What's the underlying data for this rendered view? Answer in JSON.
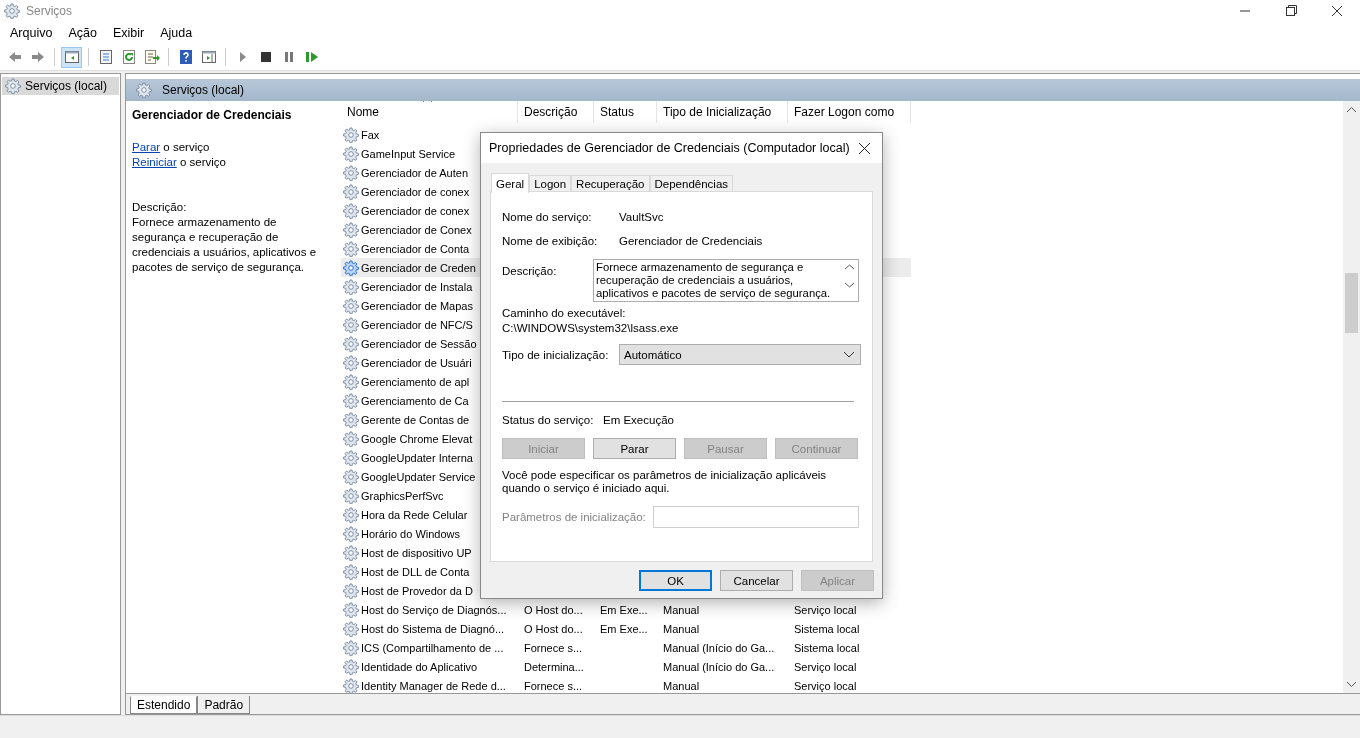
{
  "window": {
    "title": "Serviços"
  },
  "menu": [
    "Arquivo",
    "Ação",
    "Exibir",
    "Ajuda"
  ],
  "toolbar": [
    {
      "kind": "back",
      "pressed": false
    },
    {
      "kind": "forward",
      "pressed": false
    },
    {
      "kind": "sep"
    },
    {
      "kind": "console-tree",
      "pressed": true
    },
    {
      "kind": "sep"
    },
    {
      "kind": "properties",
      "pressed": false
    },
    {
      "kind": "refresh",
      "pressed": false
    },
    {
      "kind": "export",
      "pressed": false
    },
    {
      "kind": "sep"
    },
    {
      "kind": "help",
      "pressed": false
    },
    {
      "kind": "action-pane",
      "pressed": false
    },
    {
      "kind": "sep"
    },
    {
      "kind": "play",
      "pressed": false
    },
    {
      "kind": "stop",
      "pressed": false
    },
    {
      "kind": "pause",
      "pressed": false
    },
    {
      "kind": "resume",
      "pressed": false
    }
  ],
  "tree": {
    "items": [
      {
        "label": "Serviços (local)",
        "selected": true
      }
    ]
  },
  "panel": {
    "title": "Serviços (local)"
  },
  "details": {
    "service": "Gerenciador de Credenciais",
    "actions": [
      {
        "link": "Parar",
        "text": "o serviço"
      },
      {
        "link": "Reiniciar",
        "text": "o serviço"
      }
    ],
    "description_label": "Descrição:",
    "description": "Fornece armazenamento de segurança e recuperação de credenciais a usuários, aplicativos e pacotes de serviço de segurança."
  },
  "table": {
    "columns": [
      "Nome",
      "Descrição",
      "Status",
      "Tipo de Inicialização",
      "Fazer Logon como"
    ],
    "rows": [
      {
        "name": "Fax",
        "selected": false
      },
      {
        "name": "GameInput Service",
        "selected": false
      },
      {
        "name": "Gerenciador de Auten",
        "selected": false
      },
      {
        "name": "Gerenciador de conex",
        "selected": false
      },
      {
        "name": "Gerenciador de conex",
        "selected": false
      },
      {
        "name": "Gerenciador de Conex",
        "selected": false
      },
      {
        "name": "Gerenciador de Conta",
        "selected": false
      },
      {
        "name": "Gerenciador de Creden",
        "selected": true
      },
      {
        "name": "Gerenciador de Instala",
        "selected": false
      },
      {
        "name": "Gerenciador de Mapas",
        "selected": false
      },
      {
        "name": "Gerenciador de NFC/S",
        "selected": false
      },
      {
        "name": "Gerenciador de Sessão",
        "selected": false
      },
      {
        "name": "Gerenciador de Usuári",
        "selected": false
      },
      {
        "name": "Gerenciamento de apl",
        "selected": false
      },
      {
        "name": "Gerenciamento de Ca",
        "selected": false
      },
      {
        "name": "Gerente de Contas de",
        "selected": false
      },
      {
        "name": "Google Chrome Elevat",
        "selected": false
      },
      {
        "name": "GoogleUpdater Interna",
        "selected": false
      },
      {
        "name": "GoogleUpdater Service",
        "selected": false
      },
      {
        "name": "GraphicsPerfSvc",
        "selected": false
      },
      {
        "name": "Hora da Rede Celular",
        "selected": false
      },
      {
        "name": "Horário do Windows",
        "selected": false
      },
      {
        "name": "Host de dispositivo UP",
        "selected": false
      },
      {
        "name": "Host de DLL de Conta",
        "selected": false
      },
      {
        "name": "Host de Provedor da D",
        "selected": false
      },
      {
        "name": "Host do Serviço de Diagnós...",
        "description": "O Host do...",
        "status": "Em Exe...",
        "startup": "Manual",
        "logon": "Serviço local",
        "selected": false
      },
      {
        "name": "Host do Sistema de Diagnó...",
        "description": "O Host do...",
        "status": "Em Exe...",
        "startup": "Manual",
        "logon": "Sistema local",
        "selected": false
      },
      {
        "name": "ICS (Compartilhamento de ...",
        "description": "Fornece s...",
        "startup": "Manual (Início do Ga...",
        "logon": "Sistema local",
        "selected": false
      },
      {
        "name": "Identidade do Aplicativo",
        "description": "Determina...",
        "startup": "Manual (Início do Ga...",
        "logon": "Serviço local",
        "selected": false
      },
      {
        "name": "Identity Manager de Rede d...",
        "description": "Fornece s...",
        "startup": "Manual",
        "logon": "Serviço local",
        "selected": false
      }
    ]
  },
  "view_tabs": [
    {
      "label": "Estendido",
      "selected": true
    },
    {
      "label": "Padrão",
      "selected": false
    }
  ],
  "dialog": {
    "title": "Propriedades de Gerenciador de Credenciais (Computador local)",
    "tabs": [
      {
        "label": "Geral",
        "selected": true
      },
      {
        "label": "Logon",
        "selected": false
      },
      {
        "label": "Recuperação",
        "selected": false
      },
      {
        "label": "Dependências",
        "selected": false
      }
    ],
    "service_name_label": "Nome do serviço:",
    "service_name": "VaultSvc",
    "display_name_label": "Nome de exibição:",
    "display_name": "Gerenciador de Credenciais",
    "description_label": "Descrição:",
    "description": "Fornece armazenamento de segurança e recuperação de credenciais a usuários, aplicativos e pacotes de serviço de segurança.",
    "path_label": "Caminho do executável:",
    "path": "C:\\WINDOWS\\system32\\lsass.exe",
    "startup_label": "Tipo de inicialização:",
    "startup": "Automático",
    "status_label": "Status do serviço:",
    "status": "Em Execução",
    "service_buttons": [
      {
        "label": "Iniciar",
        "disabled": true
      },
      {
        "label": "Parar",
        "disabled": false
      },
      {
        "label": "Pausar",
        "disabled": true
      },
      {
        "label": "Continuar",
        "disabled": true
      }
    ],
    "hint": "Você pode especificar os parâmetros de inicialização aplicáveis quando o serviço é iniciado aqui.",
    "params_label": "Parâmetros de inicialização:",
    "params_disabled": true,
    "buttons": [
      {
        "label": "OK",
        "default": true,
        "disabled": false
      },
      {
        "label": "Cancelar",
        "default": false,
        "disabled": false
      },
      {
        "label": "Aplicar",
        "default": false,
        "disabled": true
      }
    ]
  }
}
